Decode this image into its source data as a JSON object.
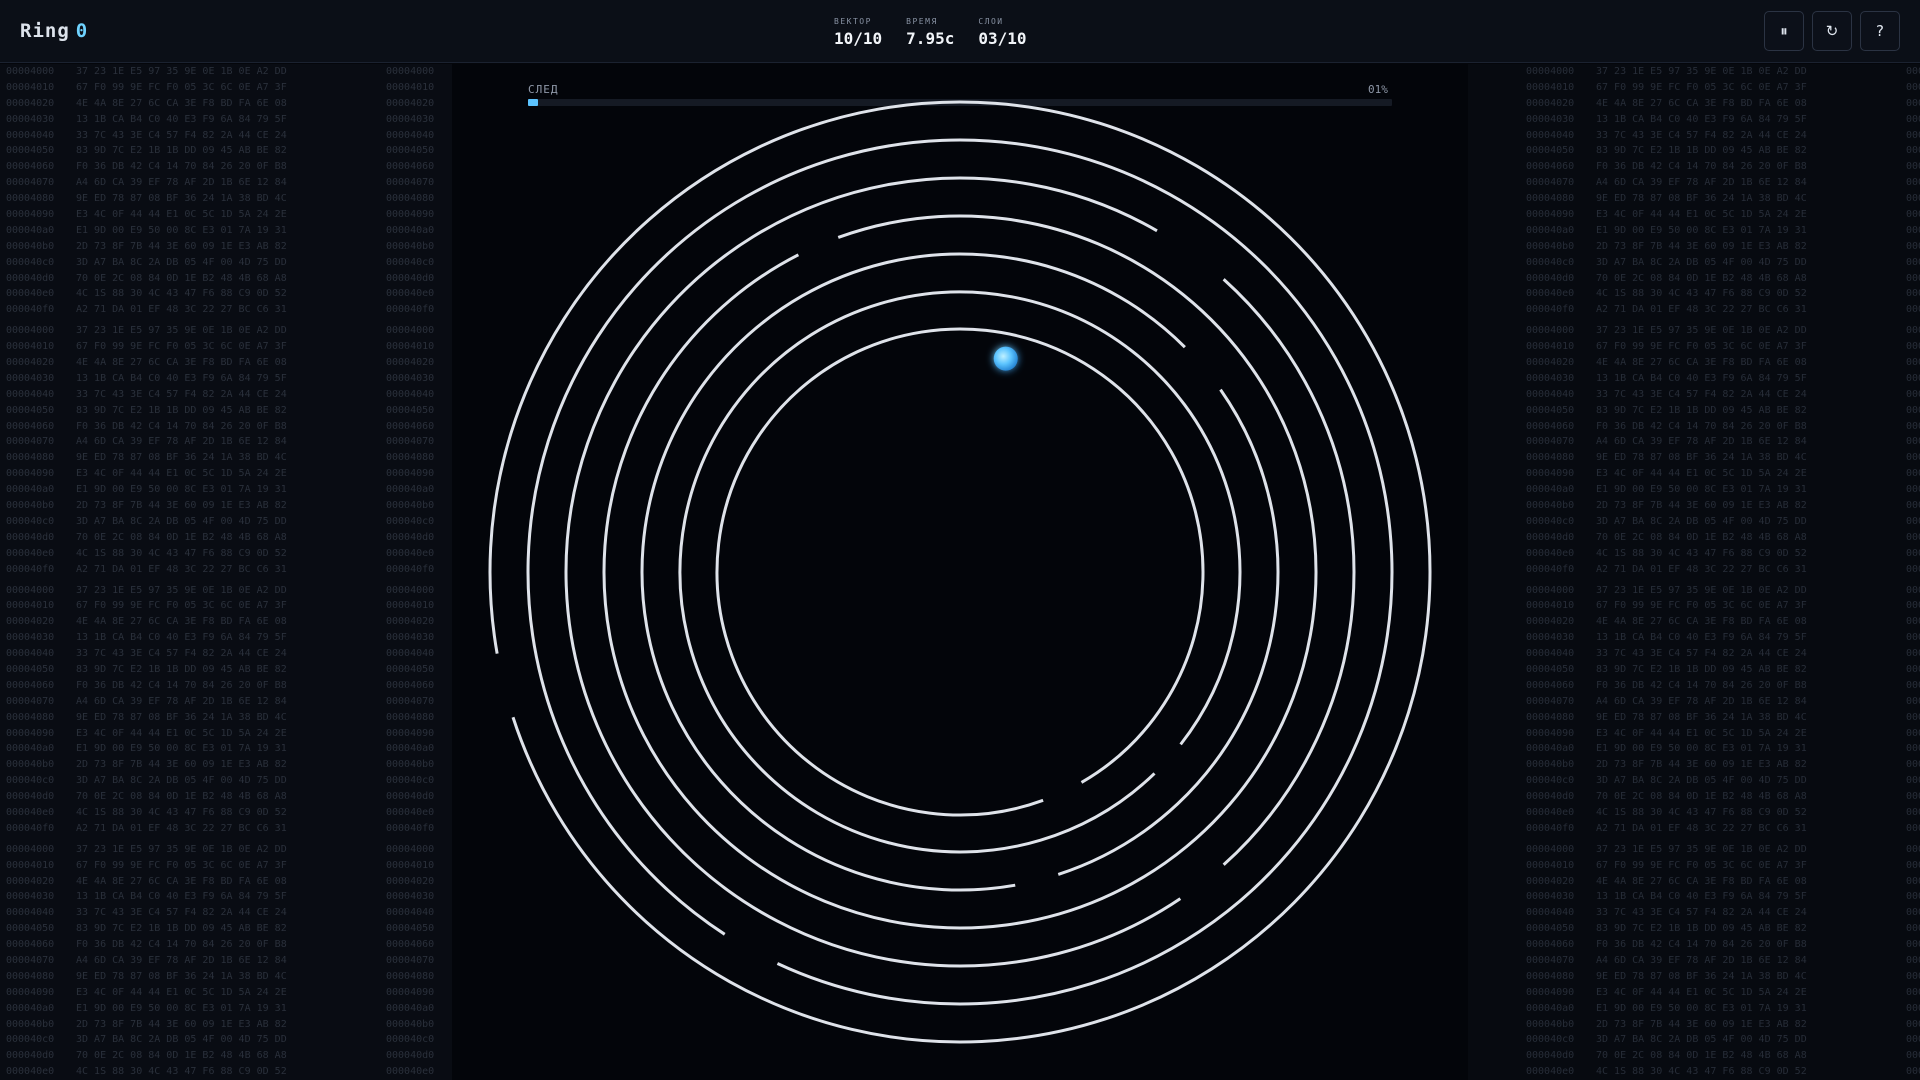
{
  "header": {
    "title": "Ring",
    "score": "0",
    "stats": [
      {
        "label": "ВЕКТОР",
        "value": "10/10"
      },
      {
        "label": "ВРЕМЯ",
        "value": "7.95с"
      },
      {
        "label": "СЛОИ",
        "value": "03/10"
      }
    ],
    "buttons": [
      {
        "name": "pause-button",
        "icon": "pause-icon",
        "glyph": "⏸"
      },
      {
        "name": "restart-button",
        "icon": "restart-icon",
        "glyph": "↻"
      },
      {
        "name": "help-button",
        "icon": "help-icon",
        "glyph": "?"
      }
    ]
  },
  "trace": {
    "label": "СЛЕД",
    "percent_text": "01%",
    "progress": 0.01
  },
  "colors": {
    "accent": "#5cc4ff",
    "ring": "#dfe3ea",
    "background": "#03050a"
  },
  "game": {
    "rings": [
      {
        "gaps_deg": [
          [
            162,
            170
          ]
        ]
      },
      {
        "gaps_deg": [
          [
            115,
            123
          ]
        ]
      },
      {
        "gaps_deg": [
          [
            48,
            56
          ],
          [
            300,
            312
          ]
        ]
      },
      {
        "gaps_deg": [
          [
            243,
            250
          ]
        ]
      },
      {
        "gaps_deg": [
          [
            72,
            80
          ],
          [
            315,
            325
          ]
        ]
      },
      {
        "gaps_deg": [
          [
            38,
            46
          ]
        ]
      },
      {
        "gaps_deg": [
          [
            60,
            70
          ]
        ]
      }
    ],
    "player": {
      "x_offset": 0.045,
      "y_offset": -0.21
    }
  },
  "hex": {
    "addresses": [
      "00004000",
      "00004010",
      "00004020",
      "00004030",
      "00004040",
      "00004050",
      "00004060",
      "00004070",
      "00004080",
      "00004090",
      "000040a0",
      "000040b0",
      "000040c0",
      "000040d0",
      "000040e0",
      "000040f0"
    ],
    "bytes": [
      "37 23 1E E5 97 35 9E 0E 1B 0E A2 DD",
      "67 F0 99 9E FC F0 05 3C 6C 0E A7 3F",
      "4E 4A 8E 27 6C CA 3E F8 BD FA 6E 08",
      "13 1B CA B4 C0 40 E3 F9 6A 84 79 5F",
      "33 7C 43 3E C4 57 F4 82 2A 44 CE 24",
      "83 9D 7C E2 1B 1B DD 09 45 AB BE 82",
      "F0 36 DB 42 C4 14 70 84 26 20 0F B8",
      "A4 6D CA 39 EF 78 AF 2D 1B 6E 12 84",
      "9E ED 78 87 08 BF 36 24 1A 38 BD 4C",
      "E3 4C 0F 44 44 E1 0C 5C 1D 5A 24 2E",
      "E1 9D 00 E9 50 00 8C E3 01 7A 19 31",
      "2D 73 8F 7B 44 3E 60 09 1E E3 AB 82",
      "3D A7 BA 8C 2A DB 05 4F 00 4D 75 DD",
      "70 0E 2C 08 84 0D 1E B2 48 4B 68 A8",
      "4C 1S 88 30 4C 43 47 F6 88 C9 0D 52",
      "A2 71 DA 01 EF 48 3C 22 27 BC C6 31"
    ]
  }
}
